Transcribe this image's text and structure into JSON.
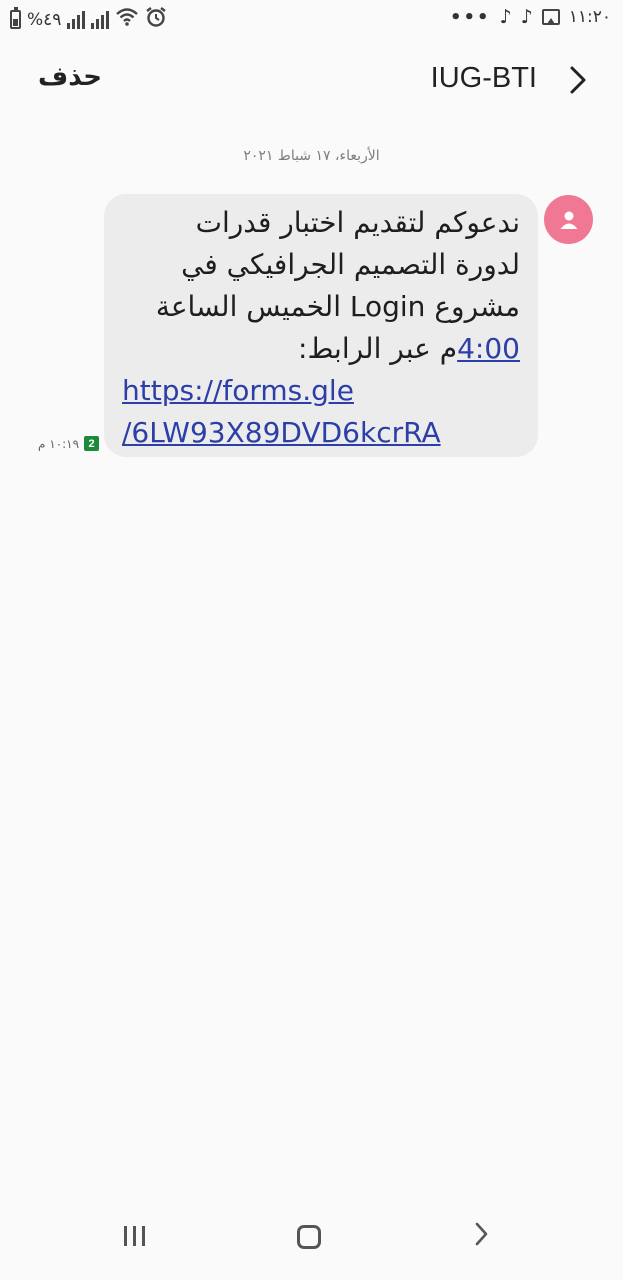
{
  "status_bar": {
    "battery_text": "%٤٩",
    "time": "١١:٢٠",
    "more": "•••",
    "icons": [
      "battery-icon",
      "signal-icon",
      "signal-icon",
      "wifi-icon",
      "alarm-icon",
      "tiktok-icon",
      "tiktok-icon",
      "gallery-icon"
    ]
  },
  "header": {
    "title": "IUG-BTI",
    "delete_label": "حذف",
    "back_icon": "chevron-right-icon"
  },
  "conversation": {
    "date": "الأربعاء، ١٧ شباط ٢٠٢١",
    "message": {
      "line1": "ندعوكم لتقديم اختبار قدرات",
      "line2": "لدورة التصميم الجرافيكي في",
      "line3_a": "مشروع ",
      "line3_b": "Login",
      "line3_c": " الخميس الساعة",
      "line4_a": "4:00",
      "line4_b": "م عبر الرابط:",
      "link_line1": "https://forms.gle",
      "link_line2": "/6LW93X89DVD6kcrRA",
      "time": "١٠:١٩ م",
      "sim": "2"
    },
    "avatar_color": "#f07895"
  },
  "colors": {
    "bubble": "#ececec",
    "link": "#2c3fa8",
    "sim_badge": "#1b8a3a"
  }
}
